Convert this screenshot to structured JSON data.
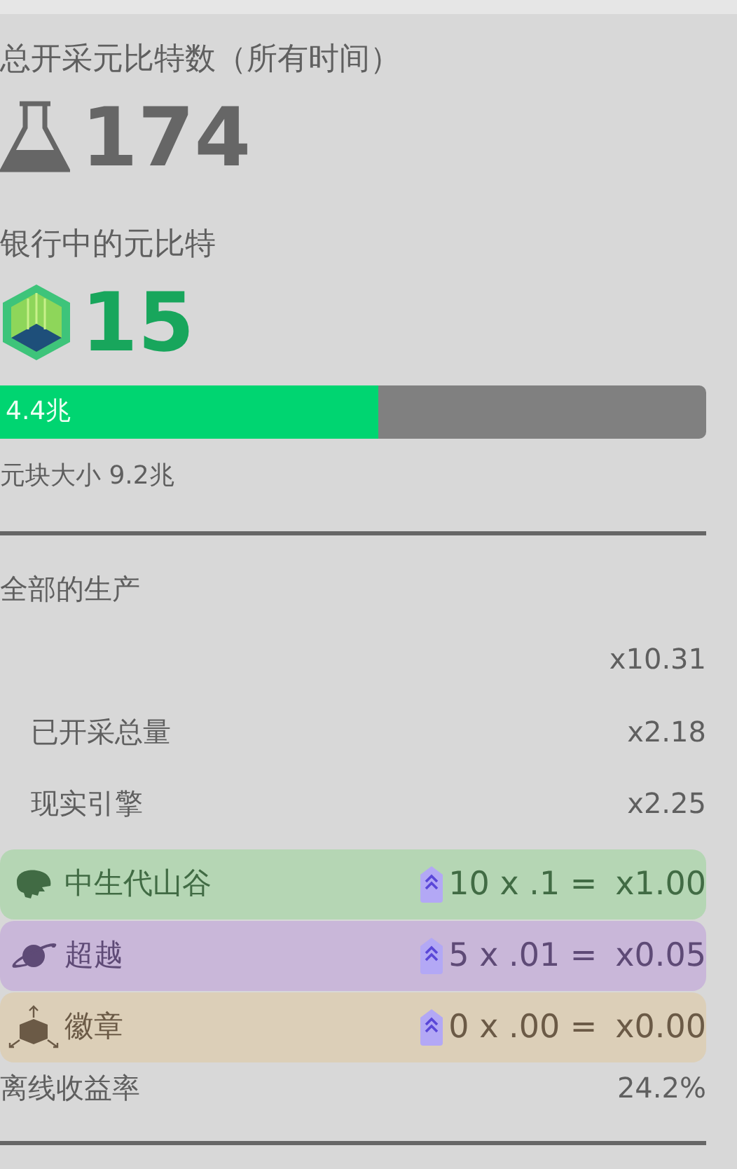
{
  "total_mined": {
    "label": "总开采元比特数（所有时间）",
    "value": "174"
  },
  "bank": {
    "label": "银行中的元比特",
    "value": "15"
  },
  "progress": {
    "level": 0.536,
    "reading": "4.4兆"
  },
  "block_size": "元块大小 9.2兆",
  "production": {
    "title": "全部的生产",
    "total": "x10.31",
    "factors": [
      {
        "label": "已开采总量",
        "value": "x2.18"
      },
      {
        "label": "现实引擎",
        "value": "x2.25"
      }
    ],
    "bonuses": [
      {
        "kind": "dinosaur",
        "name": "中生代山谷",
        "color": "#b5d6b4",
        "formula": "10 x .1 =",
        "result": "x1.00"
      },
      {
        "kind": "planet",
        "name": "超越",
        "color": "#c9b7d9",
        "formula": "5 x .01 =",
        "result": "x0.05"
      },
      {
        "kind": "box",
        "name": "徽章",
        "color": "#dccfb8",
        "formula": "0 x .00 =",
        "result": "x0.00"
      }
    ]
  },
  "offline": {
    "label": "离线收益率",
    "value": "24.2%"
  }
}
